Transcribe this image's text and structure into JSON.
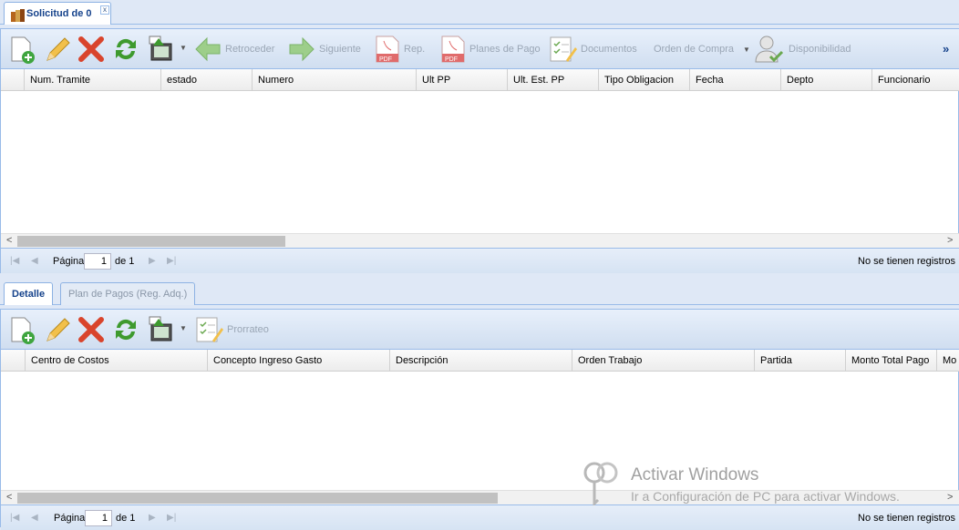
{
  "window": {
    "tab_title": "Solicitud de 0",
    "close_glyph": "x"
  },
  "toolbar": {
    "overflow": "»",
    "buttons": [
      {
        "name": "new-icon",
        "label": ""
      },
      {
        "name": "edit-icon",
        "label": ""
      },
      {
        "name": "delete-icon",
        "label": ""
      },
      {
        "name": "refresh-icon",
        "label": ""
      },
      {
        "name": "export-icon",
        "label": ""
      },
      {
        "name": "back-button",
        "label": "Retroceder"
      },
      {
        "name": "next-button",
        "label": "Siguiente"
      },
      {
        "name": "report-button",
        "label": "Rep."
      },
      {
        "name": "payment-plans-button",
        "label": "Planes de Pago"
      },
      {
        "name": "documents-button",
        "label": "Documentos"
      },
      {
        "name": "purchase-order-button",
        "label": "Orden de Compra"
      },
      {
        "name": "availability-button",
        "label": "Disponibilidad"
      }
    ],
    "pdf_text": "PDF"
  },
  "grid": {
    "columns": [
      "Num. Tramite",
      "estado",
      "Numero",
      "Ult PP",
      "Ult. Est. PP",
      "Tipo Obligacion",
      "Fecha",
      "Depto",
      "Funcionario"
    ]
  },
  "pager": {
    "page_label": "Página",
    "page_value": "1",
    "of_label": "de 1",
    "status": "No se tienen registros"
  },
  "subtabs": [
    {
      "label": "Detalle",
      "active": true
    },
    {
      "label": "Plan de Pagos (Reg. Adq.)",
      "active": false
    }
  ],
  "detail_toolbar": {
    "prorrateo": "Prorrateo"
  },
  "detail_grid": {
    "columns": [
      "Centro de Costos",
      "Concepto Ingreso Gasto",
      "Descripción",
      "Orden Trabajo",
      "Partida",
      "Monto Total Pago",
      "Mo"
    ]
  },
  "detail_pager": {
    "page_label": "Página",
    "page_value": "1",
    "of_label": "de 1",
    "status": "No se tienen registros"
  },
  "watermark": {
    "line1": "Activar Windows",
    "line2": "Ir a Configuración de PC para activar Windows."
  },
  "colors": {
    "accent": "#15428b",
    "border": "#99bbe8",
    "toolbar": "#d0def0"
  }
}
